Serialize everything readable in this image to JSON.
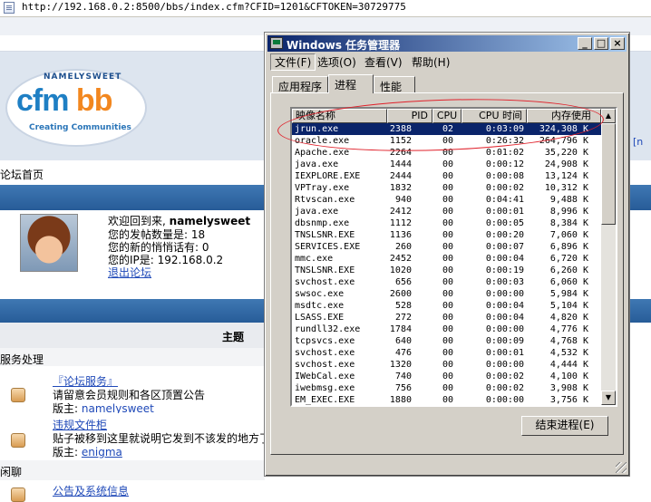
{
  "browser": {
    "url": "http://192.168.0.2:8500/bbs/index.cfm?CFID=1201&CFTOKEN=30729775"
  },
  "forum": {
    "logo": {
      "top_text": "NAMELYSWEET",
      "main_text_a": "cfm",
      "main_text_b": "bb",
      "sub_text": "Creating Communities"
    },
    "breadcrumb": "论坛首页",
    "right_stub": "[n",
    "welcome": {
      "line1_prefix": "欢迎回到来,",
      "username": "namelysweet",
      "line2": "您的发帖数量是: 18",
      "line3": "您的新的悄悄话有: 0",
      "line4": "您的IP是: 192.168.0.2",
      "logout": "退出论坛"
    },
    "topic_header": "主题",
    "section1": "服务处理",
    "forums": [
      {
        "title": "『论坛服务』",
        "desc": "请留意会员规则和各区顶置公告",
        "moderator_label": "版主:",
        "moderator": "namelysweet"
      },
      {
        "title": "违规文件柜",
        "desc": "贴子被移到这里就说明它发到不该发的地方了",
        "moderator_label": "版主:",
        "moderator": "enigma"
      }
    ],
    "section2": "闲聊",
    "forum3_title": "公告及系统信息"
  },
  "taskmgr": {
    "title": "Windows 任务管理器",
    "menu": [
      {
        "label": "文件(F)"
      },
      {
        "label": "选项(O)"
      },
      {
        "label": "查看(V)"
      },
      {
        "label": "帮助(H)"
      }
    ],
    "tabs": [
      "应用程序",
      "进程",
      "性能"
    ],
    "active_tab": "进程",
    "columns": [
      "映像名称",
      "PID",
      "CPU",
      "CPU 时间",
      "内存使用"
    ],
    "processes": [
      {
        "name": "jrun.exe",
        "pid": "2388",
        "cpu": "02",
        "time": "0:03:09",
        "mem": "324,308 K",
        "selected": true
      },
      {
        "name": "oracle.exe",
        "pid": "1152",
        "cpu": "00",
        "time": "0:26:32",
        "mem": "264,796 K"
      },
      {
        "name": "Apache.exe",
        "pid": "2264",
        "cpu": "00",
        "time": "0:01:02",
        "mem": "35,220 K"
      },
      {
        "name": "java.exe",
        "pid": "1444",
        "cpu": "00",
        "time": "0:00:12",
        "mem": "24,908 K"
      },
      {
        "name": "IEXPLORE.EXE",
        "pid": "2444",
        "cpu": "00",
        "time": "0:00:08",
        "mem": "13,124 K"
      },
      {
        "name": "VPTray.exe",
        "pid": "1832",
        "cpu": "00",
        "time": "0:00:02",
        "mem": "10,312 K"
      },
      {
        "name": "Rtvscan.exe",
        "pid": "940",
        "cpu": "00",
        "time": "0:04:41",
        "mem": "9,488 K"
      },
      {
        "name": "java.exe",
        "pid": "2412",
        "cpu": "00",
        "time": "0:00:01",
        "mem": "8,996 K"
      },
      {
        "name": "dbsnmp.exe",
        "pid": "1112",
        "cpu": "00",
        "time": "0:00:05",
        "mem": "8,384 K"
      },
      {
        "name": "TNSLSNR.EXE",
        "pid": "1136",
        "cpu": "00",
        "time": "0:00:20",
        "mem": "7,060 K"
      },
      {
        "name": "SERVICES.EXE",
        "pid": "260",
        "cpu": "00",
        "time": "0:00:07",
        "mem": "6,896 K"
      },
      {
        "name": "mmc.exe",
        "pid": "2452",
        "cpu": "00",
        "time": "0:00:04",
        "mem": "6,720 K"
      },
      {
        "name": "TNSLSNR.EXE",
        "pid": "1020",
        "cpu": "00",
        "time": "0:00:19",
        "mem": "6,260 K"
      },
      {
        "name": "svchost.exe",
        "pid": "656",
        "cpu": "00",
        "time": "0:00:03",
        "mem": "6,060 K"
      },
      {
        "name": "swsoc.exe",
        "pid": "2600",
        "cpu": "00",
        "time": "0:00:00",
        "mem": "5,984 K"
      },
      {
        "name": "msdtc.exe",
        "pid": "528",
        "cpu": "00",
        "time": "0:00:04",
        "mem": "5,104 K"
      },
      {
        "name": "LSASS.EXE",
        "pid": "272",
        "cpu": "00",
        "time": "0:00:04",
        "mem": "4,820 K"
      },
      {
        "name": "rundll32.exe",
        "pid": "1784",
        "cpu": "00",
        "time": "0:00:00",
        "mem": "4,776 K"
      },
      {
        "name": "tcpsvcs.exe",
        "pid": "640",
        "cpu": "00",
        "time": "0:00:09",
        "mem": "4,768 K"
      },
      {
        "name": "svchost.exe",
        "pid": "476",
        "cpu": "00",
        "time": "0:00:01",
        "mem": "4,532 K"
      },
      {
        "name": "svchost.exe",
        "pid": "1320",
        "cpu": "00",
        "time": "0:00:00",
        "mem": "4,444 K"
      },
      {
        "name": "IWebCal.exe",
        "pid": "740",
        "cpu": "00",
        "time": "0:00:02",
        "mem": "4,100 K"
      },
      {
        "name": "iwebmsg.exe",
        "pid": "756",
        "cpu": "00",
        "time": "0:00:02",
        "mem": "3,908 K"
      },
      {
        "name": "EM_EXEC.EXE",
        "pid": "1880",
        "cpu": "00",
        "time": "0:00:00",
        "mem": "3,756 K"
      }
    ],
    "end_button": "结束进程(E)"
  }
}
